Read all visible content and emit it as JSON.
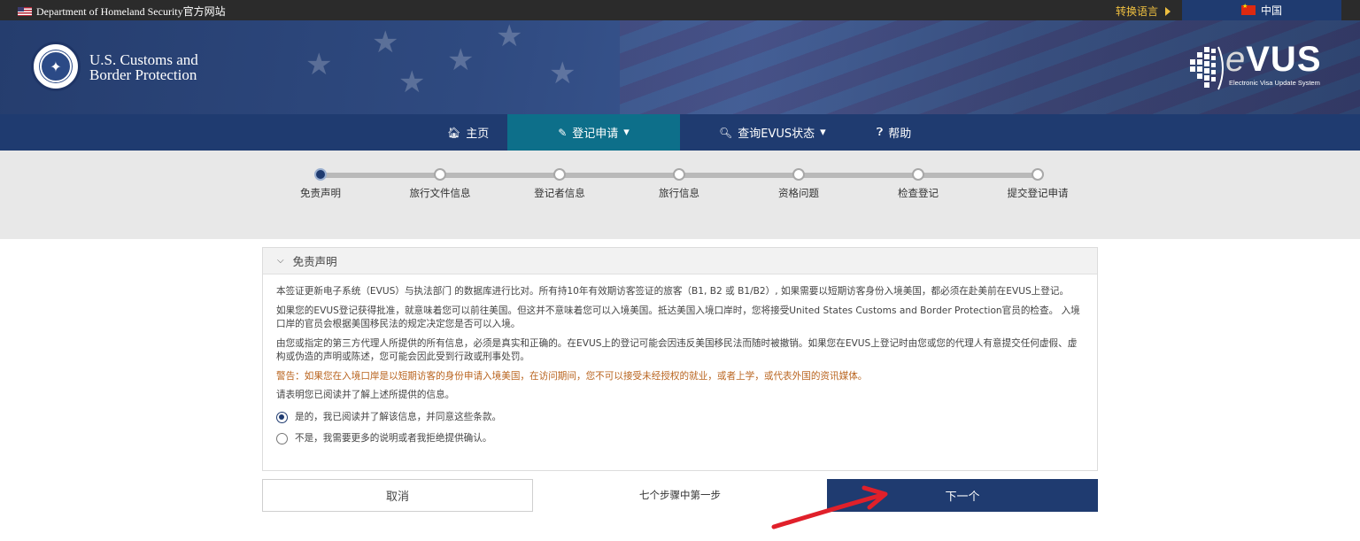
{
  "topbar": {
    "agency_label": "Department of Homeland Security官方网站",
    "switch_language": "转换语言",
    "current_language": "中国"
  },
  "header": {
    "agency_name_line1": "U.S. Customs and",
    "agency_name_line2": "Border Protection",
    "evus_logo_e": "e",
    "evus_logo_rest": "VUS",
    "evus_subtitle": "Electronic Visa Update System"
  },
  "nav": {
    "items": [
      {
        "label": "主页",
        "icon": "home-icon"
      },
      {
        "label": "登记申请",
        "icon": "pencil-icon",
        "caret": "▾"
      },
      {
        "label": "查询EVUS状态",
        "icon": "search-icon",
        "caret": "▾"
      },
      {
        "label": "帮助",
        "icon": "help-icon"
      }
    ]
  },
  "progress": {
    "steps": [
      "免责声明",
      "旅行文件信息",
      "登记者信息",
      "旅行信息",
      "资格问题",
      "检查登记",
      "提交登记申请"
    ],
    "current_step": 1
  },
  "disclaimer": {
    "title": "免责声明",
    "para1": "本签证更新电子系统（EVUS）与执法部门 的数据库进行比对。所有持10年有效期访客签证的旅客（B1, B2 或 B1/B2）, 如果需要以短期访客身份入境美国，都必须在赴美前在EVUS上登记。",
    "para2": "如果您的EVUS登记获得批准，就意味着您可以前往美国。但这并不意味着您可以入境美国。抵达美国入境口岸时，您将接受United States Customs and Border Protection官员的检查。 入境口岸的官员会根据美国移民法的规定决定您是否可以入境。",
    "para3": "由您或指定的第三方代理人所提供的所有信息，必须是真实和正确的。在EVUS上的登记可能会因违反美国移民法而随时被撤销。如果您在EVUS上登记时由您或您的代理人有意提交任何虚假、虚构或伪造的声明或陈述，您可能会因此受到行政或刑事处罚。",
    "warning": "警告：如果您在入境口岸是以短期访客的身份申请入境美国，在访问期间，您不可以接受未经授权的就业，或者上学，或代表外国的资讯媒体。",
    "prompt": "请表明您已阅读并了解上述所提供的信息。",
    "option_yes": "是的，我已阅读并了解该信息，并同意这些条款。",
    "option_no": "不是，我需要更多的说明或者我拒绝提供确认。",
    "selected": "yes"
  },
  "footer": {
    "cancel_label": "取消",
    "step_count": "七个步骤中第一步",
    "next_label": "下一个"
  },
  "colors": {
    "navy": "#1f3b70",
    "active_tab": "#0d6f8a",
    "warning_text": "#b9641f",
    "annotation_arrow": "#e0202a"
  }
}
